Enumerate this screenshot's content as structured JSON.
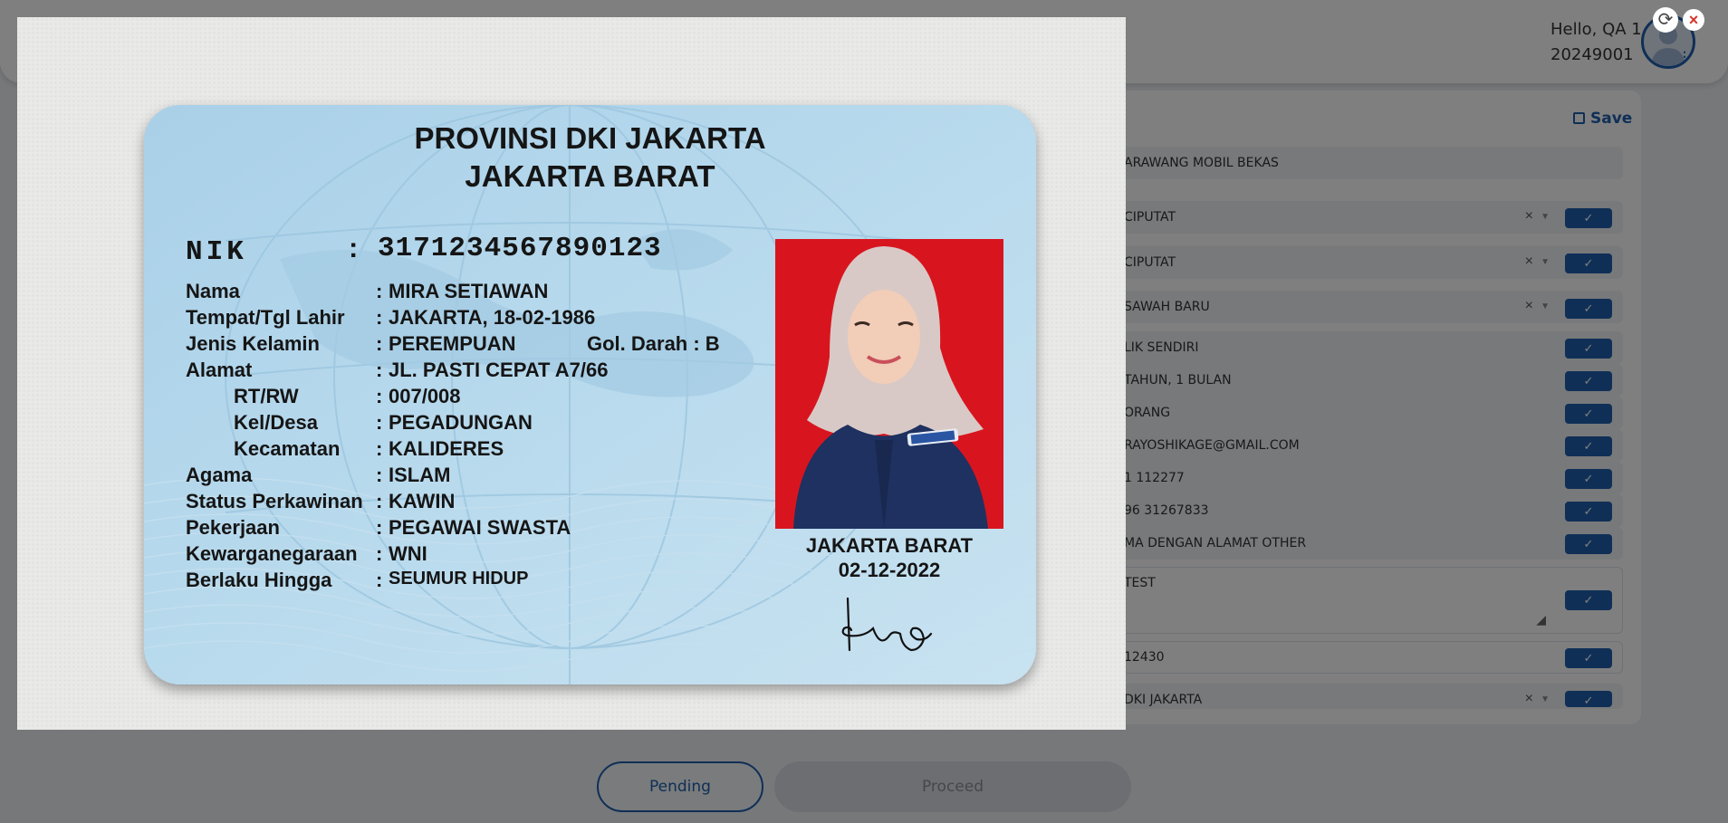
{
  "header": {
    "greeting": "Hello, QA 1",
    "user_id": "20249001",
    "avatar_icon": "user-icon",
    "menu_icon": "kebab-icon"
  },
  "form": {
    "save_label": "Save",
    "save_icon": "floppy-icon",
    "rows": [
      {
        "value": "ARAWANG MOBIL BEKAS",
        "type": "readonly"
      },
      {
        "value": "CIPUTAT",
        "type": "select"
      },
      {
        "value": "CIPUTAT",
        "type": "select"
      },
      {
        "value": "SAWAH BARU",
        "type": "select"
      },
      {
        "value": "LIK SENDIRI",
        "type": "readonly"
      },
      {
        "value": "TAHUN, 1 BULAN",
        "type": "readonly"
      },
      {
        "value": "ORANG",
        "type": "readonly"
      },
      {
        "value": "RAYOSHIKAGE@GMAIL.COM",
        "type": "readonly"
      },
      {
        "value": "1 112277",
        "type": "readonly"
      },
      {
        "value": "96 31267833",
        "type": "readonly"
      },
      {
        "value": "MA DENGAN ALAMAT OTHER",
        "type": "readonly"
      },
      {
        "value": "TEST",
        "type": "textarea"
      },
      {
        "value": "12430",
        "type": "input"
      },
      {
        "value": "DKI JAKARTA",
        "type": "select"
      }
    ]
  },
  "footer": {
    "pending_label": "Pending",
    "proceed_label": "Proceed"
  },
  "viewer": {
    "rotate_icon": "rotate-icon",
    "close_icon": "close-icon",
    "card": {
      "province": "PROVINSI DKI JAKARTA",
      "city": "JAKARTA BARAT",
      "nik_label": "NIK",
      "nik": "3171234567890123",
      "fields": [
        {
          "label": "Nama",
          "value": "MIRA SETIAWAN"
        },
        {
          "label": "Tempat/Tgl Lahir",
          "value": "JAKARTA, 18-02-1986"
        },
        {
          "label": "Jenis Kelamin",
          "value": "PEREMPUAN"
        },
        {
          "label": "Alamat",
          "value": "JL. PASTI CEPAT A7/66"
        },
        {
          "label": "RT/RW",
          "value": "007/008"
        },
        {
          "label": "Kel/Desa",
          "value": "PEGADUNGAN"
        },
        {
          "label": "Kecamatan",
          "value": "KALIDERES"
        },
        {
          "label": "Agama",
          "value": "ISLAM"
        },
        {
          "label": "Status Perkawinan",
          "value": "KAWIN"
        },
        {
          "label": "Pekerjaan",
          "value": "PEGAWAI SWASTA"
        },
        {
          "label": "Kewarganegaraan",
          "value": "WNI"
        },
        {
          "label": "Berlaku Hingga",
          "value": "SEUMUR HIDUP"
        }
      ],
      "blood_type": "Gol. Darah : B",
      "issue_city": "JAKARTA BARAT",
      "issue_date": "02-12-2022",
      "colon": ":",
      "signature": "signature"
    }
  }
}
